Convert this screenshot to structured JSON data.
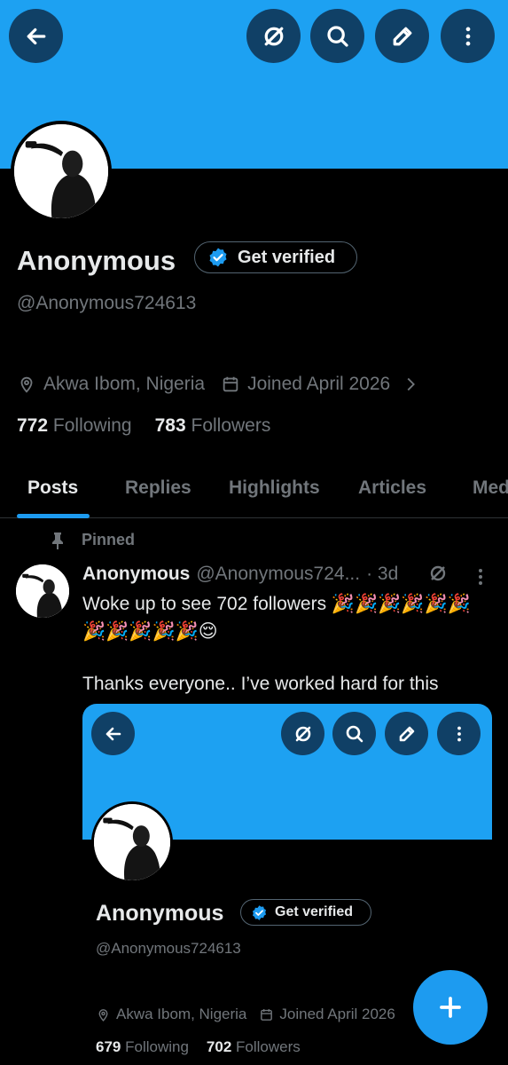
{
  "header": {
    "back_icon": "arrow-left-icon",
    "grok_icon": "grok-icon",
    "search_icon": "search-icon",
    "edit_icon": "pencil-icon",
    "more_icon": "more-vertical-icon",
    "banner_color": "#1da1f2"
  },
  "profile": {
    "name": "Anonymous",
    "verify_label": "Get verified",
    "handle": "@Anonymous724613",
    "location": "Akwa Ibom, Nigeria",
    "joined": "Joined April 2026",
    "following_count": "772",
    "following_label": "Following",
    "followers_count": "783",
    "followers_label": "Followers"
  },
  "tabs": [
    {
      "label": "Posts"
    },
    {
      "label": "Replies"
    },
    {
      "label": "Highlights"
    },
    {
      "label": "Articles"
    },
    {
      "label": "Media"
    }
  ],
  "post": {
    "pinned_label": "Pinned",
    "author": "Anonymous",
    "handle": "@Anonymous724...",
    "time": "· 3d",
    "text_line1": "Woke up to see 702 followers 🎉🎉🎉🎉🎉🎉",
    "text_line2": "🎉🎉🎉🎉🎉😌",
    "text_para2": "Thanks everyone.. I’ve worked hard for this"
  },
  "embed": {
    "name": "Anonymous",
    "verify_label": "Get verified",
    "handle": "@Anonymous724613",
    "location": "Akwa Ibom, Nigeria",
    "joined": "Joined April 2026",
    "following_count": "679",
    "following_label": "Following",
    "followers_count": "702",
    "followers_label": "Followers"
  },
  "fab": {
    "icon": "plus-icon"
  },
  "colors": {
    "accent": "#1d9bf0",
    "muted": "#71767b",
    "text": "#e7e9ea",
    "background": "#000000"
  }
}
